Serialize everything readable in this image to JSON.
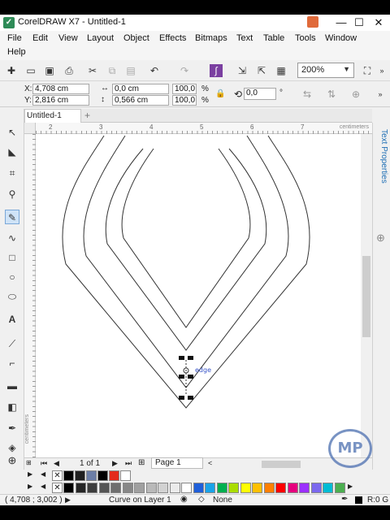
{
  "window": {
    "title": "CorelDRAW X7 - Untitled-1",
    "minimize_glyph": "—",
    "restore_glyph": "☐",
    "close_glyph": "✕"
  },
  "menu": {
    "items": [
      "File",
      "Edit",
      "View",
      "Layout",
      "Object",
      "Effects",
      "Bitmaps",
      "Text",
      "Table",
      "Tools",
      "Window",
      "Help"
    ]
  },
  "toolbar": {
    "zoom": "200%"
  },
  "properties": {
    "x": "4,708 cm",
    "y": "2,816 cm",
    "width": "0,0 cm",
    "height": "0,566 cm",
    "scale_w": "100,0",
    "scale_h": "100,0",
    "percent": "%",
    "rotation": "0,0",
    "degree": "°"
  },
  "document": {
    "tab": "Untitled-1",
    "tab_add": "+"
  },
  "ruler": {
    "units": "centimeters",
    "ticks": [
      "2",
      "3",
      "4",
      "5",
      "6",
      "7"
    ],
    "v_units": "centimeters"
  },
  "canvas": {
    "node_label": "edge"
  },
  "docker": {
    "label": "Text Properties"
  },
  "navigator": {
    "page_count": "1 of 1",
    "page_tab": "Page 1"
  },
  "palette": {
    "row1": [
      "#000000",
      "#1f1f1f",
      "#6c7ea6",
      "#000000",
      "#e32a1c",
      "#ffffff"
    ],
    "row2": [
      "#000000",
      "#262626",
      "#3d3d3d",
      "#555555",
      "#6e6e6e",
      "#878787",
      "#a0a0a0",
      "#b9b9b9",
      "#d2d2d2",
      "#ebebeb",
      "#ffffff",
      "#1f5fd9",
      "#1aa3e8",
      "#00b050",
      "#aadd00",
      "#ffff00",
      "#ffc000",
      "#ff7f00",
      "#ff0000",
      "#e6007e",
      "#9b30ff",
      "#7b68ee",
      "#00bcd4",
      "#4caf50"
    ]
  },
  "status": {
    "coords": "( 4,708 ; 3,002 )",
    "object": "Curve on Layer 1",
    "fill": "None",
    "outline": "R:0 G"
  },
  "watermark": "MP"
}
